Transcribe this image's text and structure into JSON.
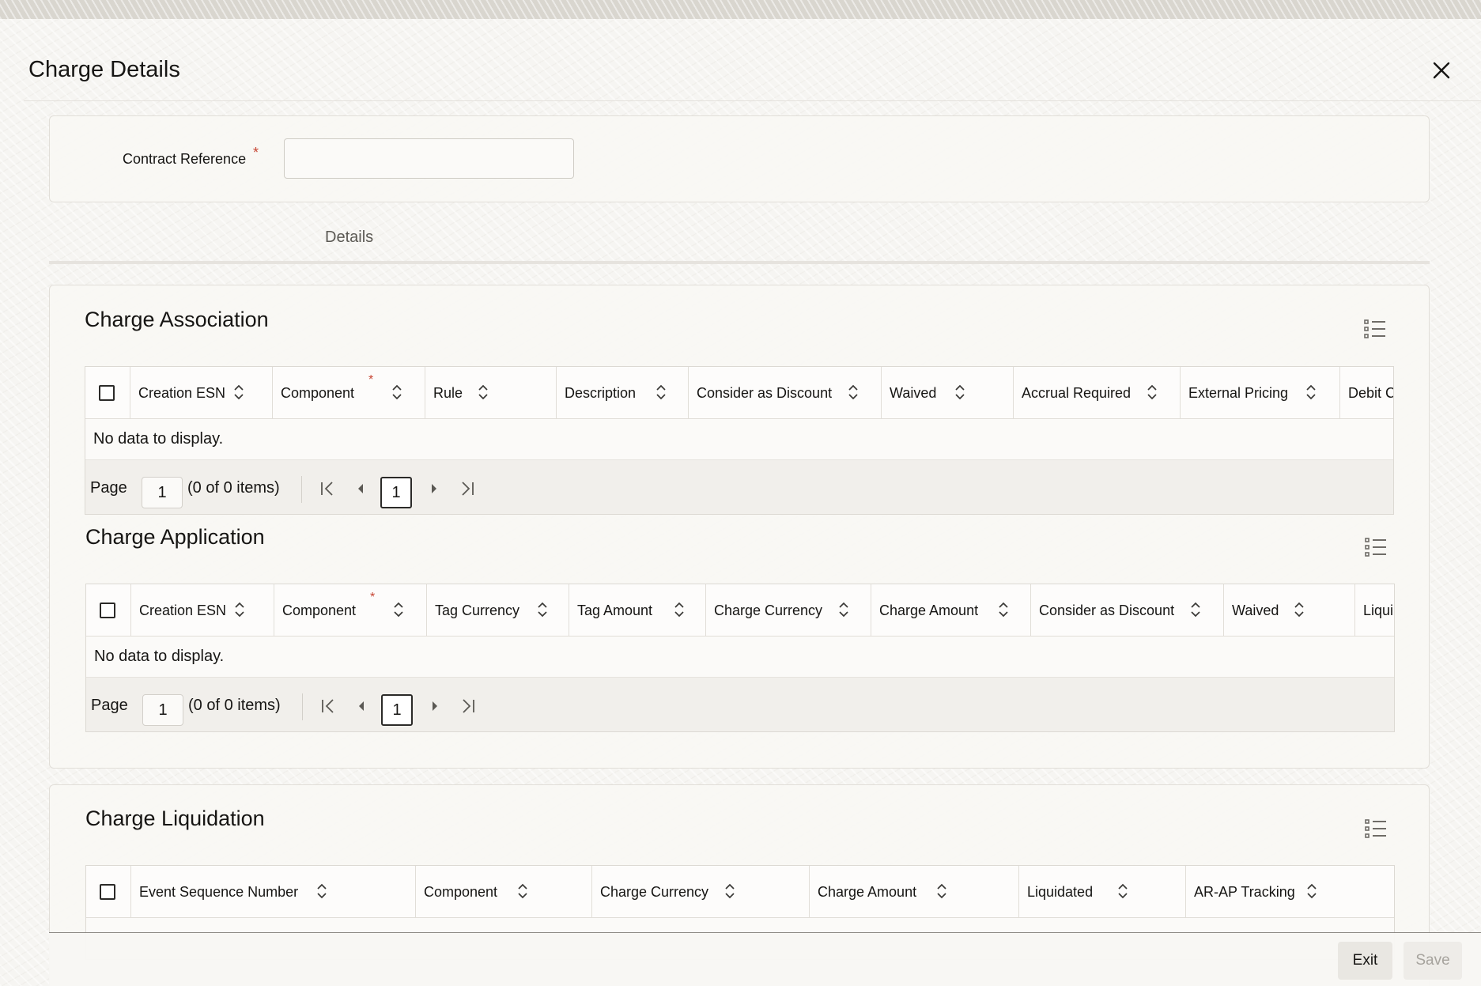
{
  "dialog": {
    "title": "Charge Details"
  },
  "contract": {
    "label": "Contract Reference",
    "required_mark": "*",
    "value": ""
  },
  "tabs": [
    {
      "label": "Details"
    }
  ],
  "charge_association": {
    "title": "Charge Association",
    "columns": [
      {
        "label": "Creation ESN"
      },
      {
        "label": "Component",
        "required_mark": "*"
      },
      {
        "label": "Rule"
      },
      {
        "label": "Description"
      },
      {
        "label": "Consider as Discount"
      },
      {
        "label": "Waived"
      },
      {
        "label": "Accrual Required"
      },
      {
        "label": "External Pricing"
      },
      {
        "label": "Debit C"
      }
    ],
    "empty_text": "No data to display.",
    "pager": {
      "label": "Page",
      "page_value": "1",
      "items_text": "(0 of 0 items)",
      "current_page": "1"
    }
  },
  "charge_application": {
    "title": "Charge Application",
    "columns": [
      {
        "label": "Creation ESN"
      },
      {
        "label": "Component",
        "required_mark": "*"
      },
      {
        "label": "Tag Currency"
      },
      {
        "label": "Tag Amount"
      },
      {
        "label": "Charge Currency"
      },
      {
        "label": "Charge Amount"
      },
      {
        "label": "Consider as Discount"
      },
      {
        "label": "Waived"
      },
      {
        "label": "Liqui"
      }
    ],
    "empty_text": "No data to display.",
    "pager": {
      "label": "Page",
      "page_value": "1",
      "items_text": "(0 of 0 items)",
      "current_page": "1"
    }
  },
  "charge_liquidation": {
    "title": "Charge Liquidation",
    "columns": [
      {
        "label": "Event Sequence Number"
      },
      {
        "label": "Component"
      },
      {
        "label": "Charge Currency"
      },
      {
        "label": "Charge Amount"
      },
      {
        "label": "Liquidated"
      },
      {
        "label": "AR-AP Tracking"
      }
    ]
  },
  "footer": {
    "exit_label": "Exit",
    "save_label": "Save"
  },
  "colors": {
    "required": "#c74634",
    "text": "#161513",
    "muted": "#a6a39d"
  }
}
